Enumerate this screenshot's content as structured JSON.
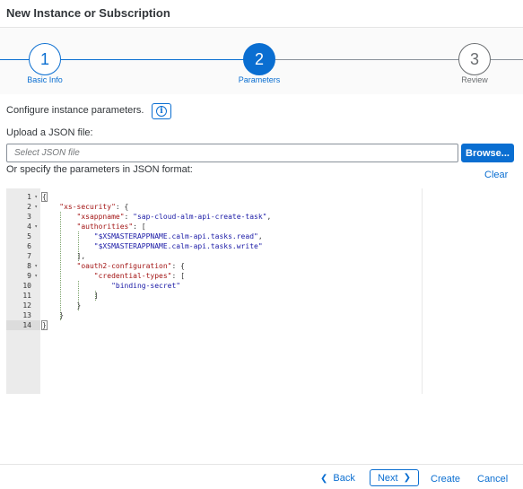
{
  "dialog": {
    "title": "New Instance or Subscription"
  },
  "wizard": {
    "steps": [
      {
        "number": "1",
        "label": "Basic Info",
        "state": "visited"
      },
      {
        "number": "2",
        "label": "Parameters",
        "state": "current"
      },
      {
        "number": "3",
        "label": "Review",
        "state": "inactive"
      }
    ]
  },
  "form": {
    "configure_text": "Configure instance parameters.",
    "upload_label": "Upload a JSON file:",
    "file_placeholder": "Select JSON file",
    "browse_label": "Browse...",
    "specify_label": "Or specify the parameters in JSON format:",
    "clear_label": "Clear"
  },
  "editor": {
    "active_line": 14,
    "lines": [
      {
        "number": "1",
        "fold": "▾",
        "text": "{"
      },
      {
        "number": "2",
        "fold": "▾",
        "text": "    \"xs-security\": {"
      },
      {
        "number": "3",
        "fold": "",
        "text": "        \"xsappname\": \"sap-cloud-alm-api-create-task\","
      },
      {
        "number": "4",
        "fold": "▾",
        "text": "        \"authorities\": ["
      },
      {
        "number": "5",
        "fold": "",
        "text": "            \"$XSMASTERAPPNAME.calm-api.tasks.read\","
      },
      {
        "number": "6",
        "fold": "",
        "text": "            \"$XSMASTERAPPNAME.calm-api.tasks.write\""
      },
      {
        "number": "7",
        "fold": "",
        "text": "        ],"
      },
      {
        "number": "8",
        "fold": "▾",
        "text": "        \"oauth2-configuration\": {"
      },
      {
        "number": "9",
        "fold": "▾",
        "text": "            \"credential-types\": ["
      },
      {
        "number": "10",
        "fold": "",
        "text": "                \"binding-secret\""
      },
      {
        "number": "11",
        "fold": "",
        "text": "            ]"
      },
      {
        "number": "12",
        "fold": "",
        "text": "        }"
      },
      {
        "number": "13",
        "fold": "",
        "text": "    }"
      },
      {
        "number": "14",
        "fold": "",
        "text": "}"
      }
    ]
  },
  "footer": {
    "back_label": "Back",
    "next_label": "Next",
    "create_label": "Create",
    "cancel_label": "Cancel"
  },
  "colors": {
    "accent": "#0a6ed1",
    "json_key": "#a31515",
    "json_string": "#1a1aa6"
  },
  "icons": {
    "info": "info-icon",
    "back": "chevron-left-icon",
    "next": "chevron-right-icon"
  }
}
